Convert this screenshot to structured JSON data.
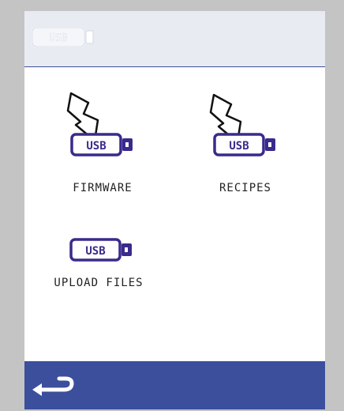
{
  "header": {
    "usb_status_label": "USB",
    "usb_status_icon": "usb-drive-outline-icon"
  },
  "tiles": [
    {
      "label": "FIRMWARE",
      "icon": "usb-drive-icon",
      "icon_text": "USB",
      "has_arrow": true
    },
    {
      "label": "RECIPES",
      "icon": "usb-drive-icon",
      "icon_text": "USB",
      "has_arrow": true
    },
    {
      "label": "UPLOAD FILES",
      "icon": "usb-drive-icon",
      "icon_text": "USB",
      "has_arrow": false
    }
  ],
  "footer": {
    "back_icon": "back-arrow-icon"
  },
  "colors": {
    "accent": "#3b4f9c",
    "usb_purple": "#3a2a8c",
    "header_bg": "#e8ecf2",
    "frame": "#c4c4c4"
  }
}
